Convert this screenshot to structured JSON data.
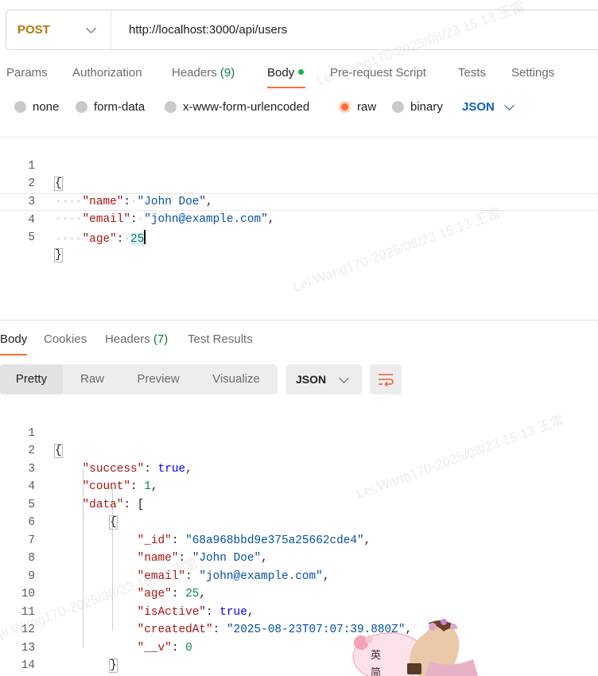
{
  "request": {
    "method": "POST",
    "url": "http://localhost:3000/api/users"
  },
  "req_tabs": {
    "params": "Params",
    "authorization": "Authorization",
    "headers": "Headers",
    "headers_count": "(9)",
    "body": "Body",
    "pre_request": "Pre-request Script",
    "tests": "Tests",
    "settings": "Settings"
  },
  "body_types": {
    "none": "none",
    "form_data": "form-data",
    "urlencoded": "x-www-form-urlencoded",
    "raw": "raw",
    "binary": "binary",
    "language": "JSON"
  },
  "request_body": {
    "line_numbers": [
      "1",
      "2",
      "3",
      "4",
      "5"
    ],
    "name_key": "\"name\"",
    "name_val": "\"John Doe\"",
    "email_key": "\"email\"",
    "email_val": "\"john@example.com\"",
    "age_key": "\"age\"",
    "age_val": "25"
  },
  "resp_tabs": {
    "body": "Body",
    "cookies": "Cookies",
    "headers": "Headers",
    "headers_count": "(7)",
    "test_results": "Test Results"
  },
  "view_modes": {
    "pretty": "Pretty",
    "raw": "Raw",
    "preview": "Preview",
    "visualize": "Visualize",
    "format": "JSON"
  },
  "response_body": {
    "line_numbers": [
      "1",
      "2",
      "3",
      "4",
      "5",
      "6",
      "7",
      "8",
      "9",
      "10",
      "11",
      "12",
      "13",
      "14"
    ],
    "success_key": "\"success\"",
    "success_val": "true",
    "count_key": "\"count\"",
    "count_val": "1",
    "data_key": "\"data\"",
    "id_key": "\"_id\"",
    "id_val": "\"68a968bbd9e375a25662cde4\"",
    "name_key": "\"name\"",
    "name_val": "\"John Doe\"",
    "email_key": "\"email\"",
    "email_val": "\"john@example.com\"",
    "age_key": "\"age\"",
    "age_val": "25",
    "active_key": "\"isActive\"",
    "active_val": "true",
    "created_key": "\"createdAt\"",
    "created_val": "\"2025-08-23T07:07:39.880Z\"",
    "v_key": "\"__v\"",
    "v_val": "0"
  },
  "watermark": "Lei.Wang170-2025/08/23  15:13 王雷",
  "ime_widget": {
    "char_top": "英",
    "char_bottom": "简"
  },
  "colors": {
    "accent": "#ff6c37",
    "method": "#ad7a03",
    "link_blue": "#0b62c4",
    "status_green": "#0cbb52"
  }
}
